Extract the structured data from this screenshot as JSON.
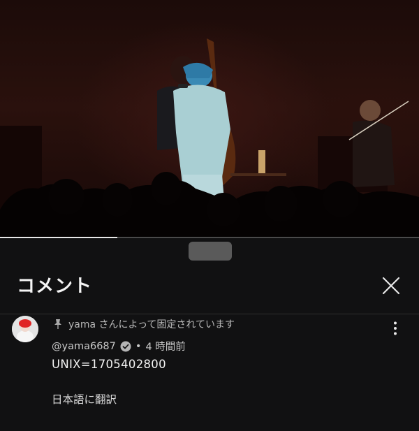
{
  "player": {
    "progress_fraction": 0.28
  },
  "comments_sheet": {
    "title": "コメント",
    "close_icon": "close-icon"
  },
  "pinned_comment": {
    "pinned_label": "yama さんによって固定されています",
    "author": "@yama6687",
    "separator": "•",
    "time_ago": "4 時間前",
    "text": "UNIX=1705402800",
    "translate_label": "日本語に翻訳"
  }
}
